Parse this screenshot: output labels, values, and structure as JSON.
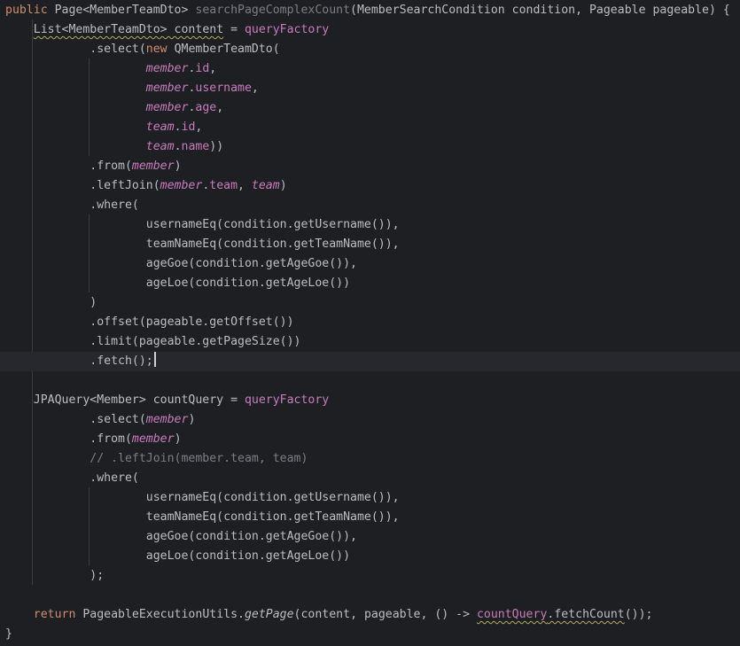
{
  "editor": {
    "lines": [
      [
        {
          "t": "public ",
          "c": "#cf8e6d"
        },
        {
          "t": "Page<MemberTeamDto> ",
          "c": "#bcbec4"
        },
        {
          "t": "searchPageComplexCount",
          "c": "#7a7e85"
        },
        {
          "t": "(MemberSearchCondition condition, Pageable pageable) {",
          "c": "#bcbec4"
        }
      ],
      [
        {
          "t": "    "
        },
        {
          "t": "List<MemberTeamDto> content",
          "c": "#bcbec4",
          "u": 1
        },
        {
          "t": " = ",
          "c": "#bcbec4"
        },
        {
          "t": "queryFactory",
          "c": "#c77dbb"
        }
      ],
      [
        {
          "t": "            .select(",
          "c": "#bcbec4"
        },
        {
          "t": "new ",
          "c": "#cf8e6d"
        },
        {
          "t": "QMemberTeamDto(",
          "c": "#bcbec4"
        }
      ],
      [
        {
          "t": "                    "
        },
        {
          "t": "member",
          "c": "#c77dbb",
          "i": 1
        },
        {
          "t": ".",
          "c": "#bcbec4"
        },
        {
          "t": "id",
          "c": "#c77dbb"
        },
        {
          "t": ",",
          "c": "#bcbec4"
        }
      ],
      [
        {
          "t": "                    "
        },
        {
          "t": "member",
          "c": "#c77dbb",
          "i": 1
        },
        {
          "t": ".",
          "c": "#bcbec4"
        },
        {
          "t": "username",
          "c": "#c77dbb"
        },
        {
          "t": ",",
          "c": "#bcbec4"
        }
      ],
      [
        {
          "t": "                    "
        },
        {
          "t": "member",
          "c": "#c77dbb",
          "i": 1
        },
        {
          "t": ".",
          "c": "#bcbec4"
        },
        {
          "t": "age",
          "c": "#c77dbb"
        },
        {
          "t": ",",
          "c": "#bcbec4"
        }
      ],
      [
        {
          "t": "                    "
        },
        {
          "t": "team",
          "c": "#c77dbb",
          "i": 1
        },
        {
          "t": ".",
          "c": "#bcbec4"
        },
        {
          "t": "id",
          "c": "#c77dbb"
        },
        {
          "t": ",",
          "c": "#bcbec4"
        }
      ],
      [
        {
          "t": "                    "
        },
        {
          "t": "team",
          "c": "#c77dbb",
          "i": 1
        },
        {
          "t": ".",
          "c": "#bcbec4"
        },
        {
          "t": "name",
          "c": "#c77dbb"
        },
        {
          "t": "))",
          "c": "#bcbec4"
        }
      ],
      [
        {
          "t": "            .from(",
          "c": "#bcbec4"
        },
        {
          "t": "member",
          "c": "#c77dbb",
          "i": 1
        },
        {
          "t": ")",
          "c": "#bcbec4"
        }
      ],
      [
        {
          "t": "            .leftJoin(",
          "c": "#bcbec4"
        },
        {
          "t": "member",
          "c": "#c77dbb",
          "i": 1
        },
        {
          "t": ".",
          "c": "#bcbec4"
        },
        {
          "t": "team",
          "c": "#c77dbb"
        },
        {
          "t": ", ",
          "c": "#bcbec4"
        },
        {
          "t": "team",
          "c": "#c77dbb",
          "i": 1
        },
        {
          "t": ")",
          "c": "#bcbec4"
        }
      ],
      [
        {
          "t": "            .where(",
          "c": "#bcbec4"
        }
      ],
      [
        {
          "t": "                    usernameEq(condition.getUsername()),",
          "c": "#bcbec4"
        }
      ],
      [
        {
          "t": "                    teamNameEq(condition.getTeamName()),",
          "c": "#bcbec4"
        }
      ],
      [
        {
          "t": "                    ageGoe(condition.getAgeGoe()),",
          "c": "#bcbec4"
        }
      ],
      [
        {
          "t": "                    ageLoe(condition.getAgeLoe())",
          "c": "#bcbec4"
        }
      ],
      [
        {
          "t": "            )",
          "c": "#bcbec4"
        }
      ],
      [
        {
          "t": "            .offset(pageable.getOffset())",
          "c": "#bcbec4"
        }
      ],
      [
        {
          "t": "            .limit(pageable.getPageSize())",
          "c": "#bcbec4"
        }
      ],
      [
        {
          "t": "            .fetch();",
          "c": "#bcbec4"
        },
        {
          "caret": 1
        }
      ],
      [],
      [
        {
          "t": "    JPAQuery<Member> countQuery = ",
          "c": "#bcbec4"
        },
        {
          "t": "queryFactory",
          "c": "#c77dbb"
        }
      ],
      [
        {
          "t": "            .select(",
          "c": "#bcbec4"
        },
        {
          "t": "member",
          "c": "#c77dbb",
          "i": 1
        },
        {
          "t": ")",
          "c": "#bcbec4"
        }
      ],
      [
        {
          "t": "            .from(",
          "c": "#bcbec4"
        },
        {
          "t": "member",
          "c": "#c77dbb",
          "i": 1
        },
        {
          "t": ")",
          "c": "#bcbec4"
        }
      ],
      [
        {
          "t": "            // .leftJoin(member.team, team)",
          "c": "#7a7e85"
        }
      ],
      [
        {
          "t": "            .where(",
          "c": "#bcbec4"
        }
      ],
      [
        {
          "t": "                    usernameEq(condition.getUsername()),",
          "c": "#bcbec4"
        }
      ],
      [
        {
          "t": "                    teamNameEq(condition.getTeamName()),",
          "c": "#bcbec4"
        }
      ],
      [
        {
          "t": "                    ageGoe(condition.getAgeGoe()),",
          "c": "#bcbec4"
        }
      ],
      [
        {
          "t": "                    ageLoe(condition.getAgeLoe())",
          "c": "#bcbec4"
        }
      ],
      [
        {
          "t": "            );",
          "c": "#bcbec4"
        }
      ],
      [],
      [
        {
          "t": "    "
        },
        {
          "t": "return ",
          "c": "#cf8e6d"
        },
        {
          "t": "PageableExecutionUtils.",
          "c": "#bcbec4"
        },
        {
          "t": "getPage",
          "c": "#bcbec4",
          "i": 1
        },
        {
          "t": "(content, pageable, () -> ",
          "c": "#bcbec4"
        },
        {
          "t": "countQuery",
          "c": "#c77dbb",
          "u": 1
        },
        {
          "t": ".fetchCount",
          "c": "#bcbec4",
          "u": 1
        },
        {
          "t": "());",
          "c": "#bcbec4"
        }
      ],
      [
        {
          "t": "}",
          "c": "#bcbec4"
        }
      ]
    ],
    "current_line": 18
  }
}
